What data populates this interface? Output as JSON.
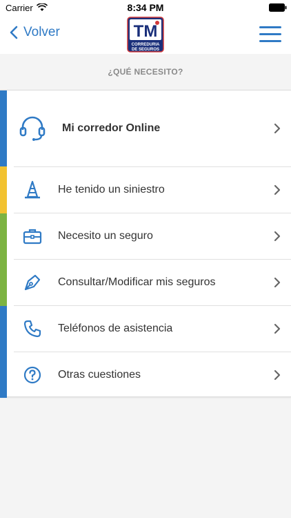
{
  "status_bar": {
    "carrier": "Carrier",
    "time": "8:34 PM"
  },
  "navbar": {
    "back_label": "Volver",
    "logo": {
      "letters": "TM",
      "caption_line1": "CORREDURIA",
      "caption_line2": "DE SEGUROS"
    }
  },
  "section": {
    "title": "¿QUÉ NECESITO?"
  },
  "colors": {
    "accent": "#2f7ac5",
    "stripe_blue": "#2f7ac5",
    "stripe_yellow": "#f2c230",
    "stripe_green": "#7cb342"
  },
  "menu_items": [
    {
      "label": "Mi corredor Online",
      "icon": "headset-icon"
    },
    {
      "label": "He tenido un siniestro",
      "icon": "traffic-cone-icon"
    },
    {
      "label": "Necesito un seguro",
      "icon": "briefcase-icon"
    },
    {
      "label": "Consultar/Modificar mis seguros",
      "icon": "pen-nib-icon"
    },
    {
      "label": "Teléfonos de asistencia",
      "icon": "phone-icon"
    },
    {
      "label": "Otras cuestiones",
      "icon": "help-circle-icon"
    }
  ]
}
